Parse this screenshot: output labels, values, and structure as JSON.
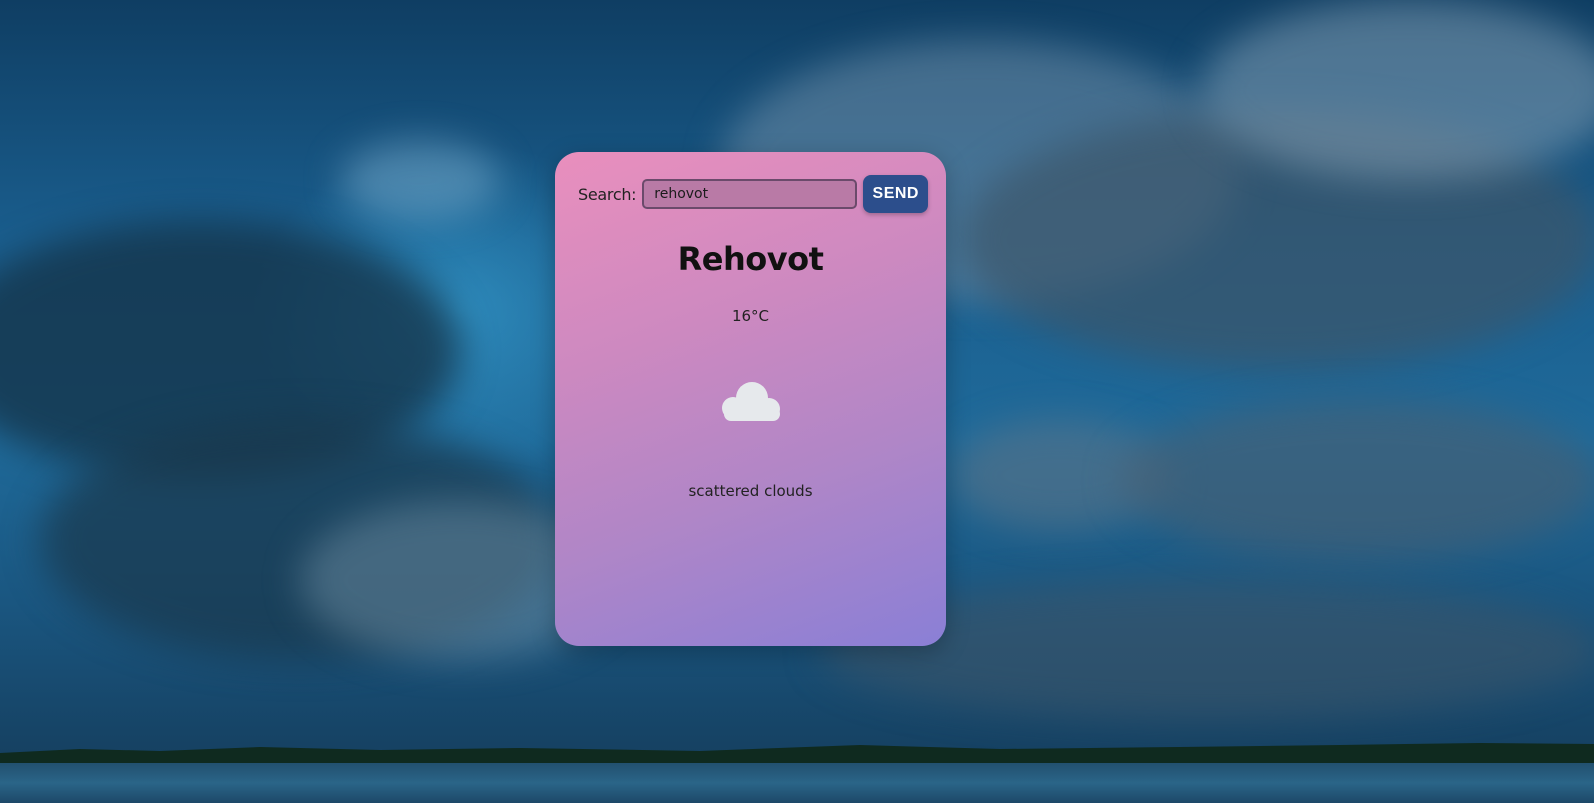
{
  "search": {
    "label": "Search:",
    "value": "rehovot",
    "send_label": "SEND"
  },
  "weather": {
    "city": "Rehovot",
    "temperature": "16°C",
    "icon": "cloud-icon",
    "description": "scattered clouds"
  },
  "colors": {
    "card_gradient_start": "#e98fbd",
    "card_gradient_end": "#8a7fd6",
    "button": "#2c4e8c",
    "background_sky": "#1a5e8e"
  }
}
